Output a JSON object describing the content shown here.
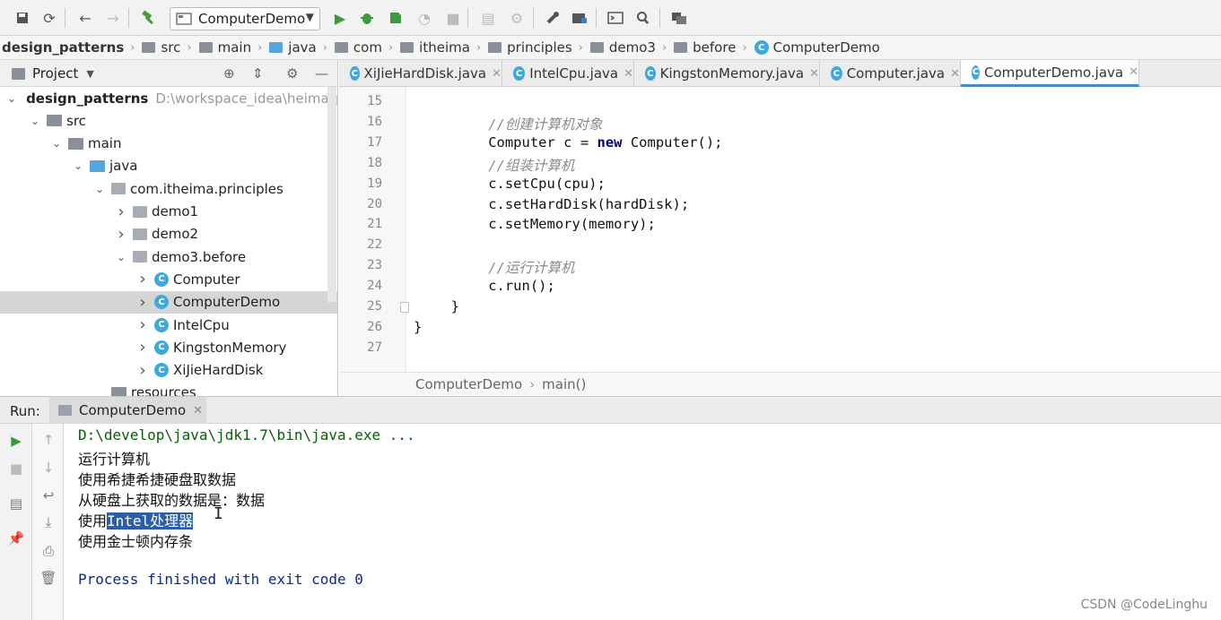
{
  "toolbar": {
    "run_config": "ComputerDemo",
    "icons": [
      "save-icon",
      "sync-icon",
      "back-icon",
      "forward-icon",
      "build-hammer-icon",
      "run-icon",
      "debug-icon",
      "coverage-icon",
      "profile-icon",
      "stop-icon",
      "sdk-icon",
      "structure-icon",
      "settings-wrench-icon",
      "project-structure-icon",
      "terminal-icon",
      "search-icon",
      "vcs-icon"
    ]
  },
  "breadcrumb": [
    "design_patterns",
    "src",
    "main",
    "java",
    "com",
    "itheima",
    "principles",
    "demo3",
    "before",
    "ComputerDemo"
  ],
  "project_panel": {
    "title": "Project",
    "tree": [
      {
        "label": "design_patterns",
        "path": "D:\\workspace_idea\\heima_pat",
        "icon": "folder",
        "chev": "down",
        "bold": true
      },
      {
        "label": "src",
        "icon": "folder",
        "chev": "down"
      },
      {
        "label": "main",
        "icon": "folder",
        "chev": "down"
      },
      {
        "label": "java",
        "icon": "folder-blue",
        "chev": "down"
      },
      {
        "label": "com.itheima.principles",
        "icon": "package",
        "chev": "down"
      },
      {
        "label": "demo1",
        "icon": "package",
        "chev": "right"
      },
      {
        "label": "demo2",
        "icon": "package",
        "chev": "right"
      },
      {
        "label": "demo3.before",
        "icon": "package",
        "chev": "down"
      },
      {
        "label": "Computer",
        "icon": "class",
        "chev": "right"
      },
      {
        "label": "ComputerDemo",
        "icon": "class-run",
        "chev": "right",
        "selected": true
      },
      {
        "label": "IntelCpu",
        "icon": "class",
        "chev": "right"
      },
      {
        "label": "KingstonMemory",
        "icon": "class",
        "chev": "right"
      },
      {
        "label": "XiJieHardDisk",
        "icon": "class",
        "chev": "right"
      },
      {
        "label": "resources",
        "icon": "folder",
        "chev": ""
      }
    ]
  },
  "editor_tabs": [
    {
      "label": "XiJieHardDisk.java",
      "active": false
    },
    {
      "label": "IntelCpu.java",
      "active": false
    },
    {
      "label": "KingstonMemory.java",
      "active": false
    },
    {
      "label": "Computer.java",
      "active": false
    },
    {
      "label": "ComputerDemo.java",
      "active": true
    }
  ],
  "code_lines": [
    {
      "n": "15",
      "text": ""
    },
    {
      "n": "16",
      "text": "//创建计算机对象",
      "type": "comment"
    },
    {
      "n": "17",
      "text": "Computer c = new Computer();",
      "type": "code"
    },
    {
      "n": "18",
      "text": "//组装计算机",
      "type": "comment"
    },
    {
      "n": "19",
      "text": "c.setCpu(cpu);",
      "type": "code"
    },
    {
      "n": "20",
      "text": "c.setHardDisk(hardDisk);",
      "type": "code"
    },
    {
      "n": "21",
      "text": "c.setMemory(memory);",
      "type": "code"
    },
    {
      "n": "22",
      "text": ""
    },
    {
      "n": "23",
      "text": "//运行计算机",
      "type": "comment"
    },
    {
      "n": "24",
      "text": "c.run();",
      "type": "code"
    },
    {
      "n": "25",
      "text": "}",
      "type": "brace1"
    },
    {
      "n": "26",
      "text": "}",
      "type": "brace0"
    },
    {
      "n": "27",
      "text": ""
    }
  ],
  "editor_breadcrumb": [
    "ComputerDemo",
    "main()"
  ],
  "run_panel": {
    "label": "Run:",
    "tab": "ComputerDemo",
    "console": [
      "D:\\develop\\java\\jdk1.7\\bin\\java.exe ...",
      "运行计算机",
      "使用希捷希捷硬盘取数据",
      "从硬盘上获取的数据是：数据",
      "使用",
      "使用金士顿内存条",
      "",
      "Process finished with exit code 0"
    ],
    "selected_text": "Intel处理器"
  },
  "watermark": "CSDN @CodeLinghu"
}
